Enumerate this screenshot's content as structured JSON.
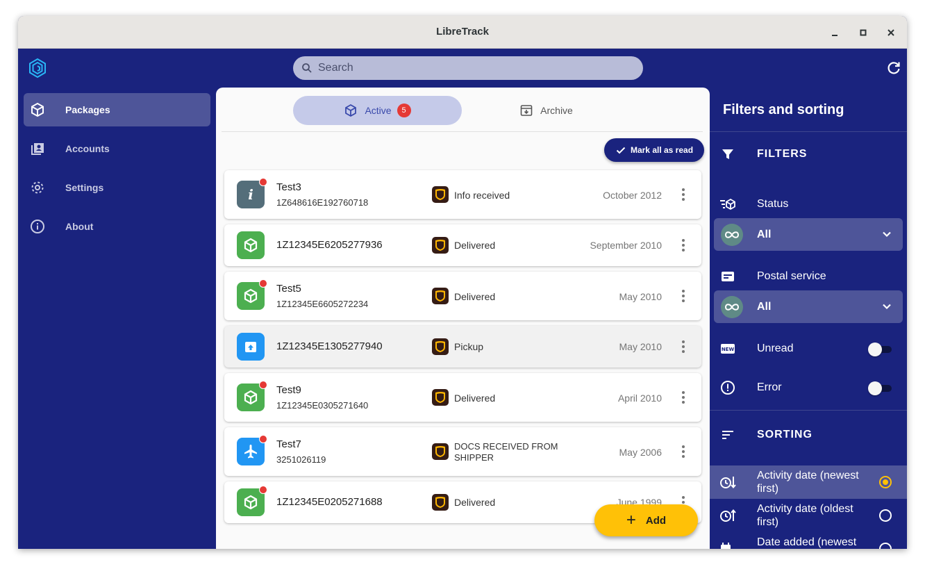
{
  "window": {
    "title": "LibreTrack",
    "minimize": "—",
    "maximize": "□",
    "close": "✕"
  },
  "search": {
    "placeholder": "Search"
  },
  "nav": {
    "items": [
      {
        "label": "Packages",
        "icon": "package-icon"
      },
      {
        "label": "Accounts",
        "icon": "accounts-icon"
      },
      {
        "label": "Settings",
        "icon": "gear-icon"
      },
      {
        "label": "About",
        "icon": "info-icon"
      }
    ]
  },
  "tabs": {
    "active_label": "Active",
    "active_count": "5",
    "archive_label": "Archive"
  },
  "mark_all_label": "Mark all as read",
  "packages": [
    {
      "name": "Test3",
      "tracking": "1Z648616E192760718",
      "status": "Info received",
      "date": "October 2012",
      "unread": true,
      "kind": "info",
      "color": "#546e7a"
    },
    {
      "name": "1Z12345E6205277936",
      "tracking": "",
      "status": "Delivered",
      "date": "September 2010",
      "unread": false,
      "kind": "delivered",
      "color": "#4caf50"
    },
    {
      "name": "Test5",
      "tracking": "1Z12345E6605272234",
      "status": "Delivered",
      "date": "May 2010",
      "unread": true,
      "kind": "delivered",
      "color": "#4caf50"
    },
    {
      "name": "1Z12345E1305277940",
      "tracking": "",
      "status": "Pickup",
      "date": "May 2010",
      "unread": false,
      "kind": "pickup",
      "color": "#2196f3"
    },
    {
      "name": "Test9",
      "tracking": "1Z12345E0305271640",
      "status": "Delivered",
      "date": "April 2010",
      "unread": true,
      "kind": "delivered",
      "color": "#4caf50"
    },
    {
      "name": "Test7",
      "tracking": "3251026119",
      "status": "DOCS RECEIVED FROM SHIPPER",
      "date": "May 2006",
      "unread": true,
      "kind": "transit",
      "color": "#2196f3"
    },
    {
      "name": "1Z12345E0205271688",
      "tracking": "",
      "status": "Delivered",
      "date": "June 1999",
      "unread": true,
      "kind": "delivered",
      "color": "#4caf50"
    }
  ],
  "fab": {
    "label": "Add"
  },
  "filters": {
    "title": "Filters and sorting",
    "filters_header": "FILTERS",
    "status_label": "Status",
    "status_value": "All",
    "postal_label": "Postal service",
    "postal_value": "All",
    "unread_label": "Unread",
    "error_label": "Error",
    "sorting_header": "SORTING",
    "sort_options": [
      {
        "label": "Activity date (newest first)",
        "selected": true
      },
      {
        "label": "Activity date (oldest first)",
        "selected": false
      },
      {
        "label": "Date added (newest first)",
        "selected": false
      }
    ]
  },
  "colors": {
    "primary": "#1a237e",
    "accent": "#ffc107",
    "unread_dot": "#e53935",
    "ups_brown": "#351c15"
  }
}
